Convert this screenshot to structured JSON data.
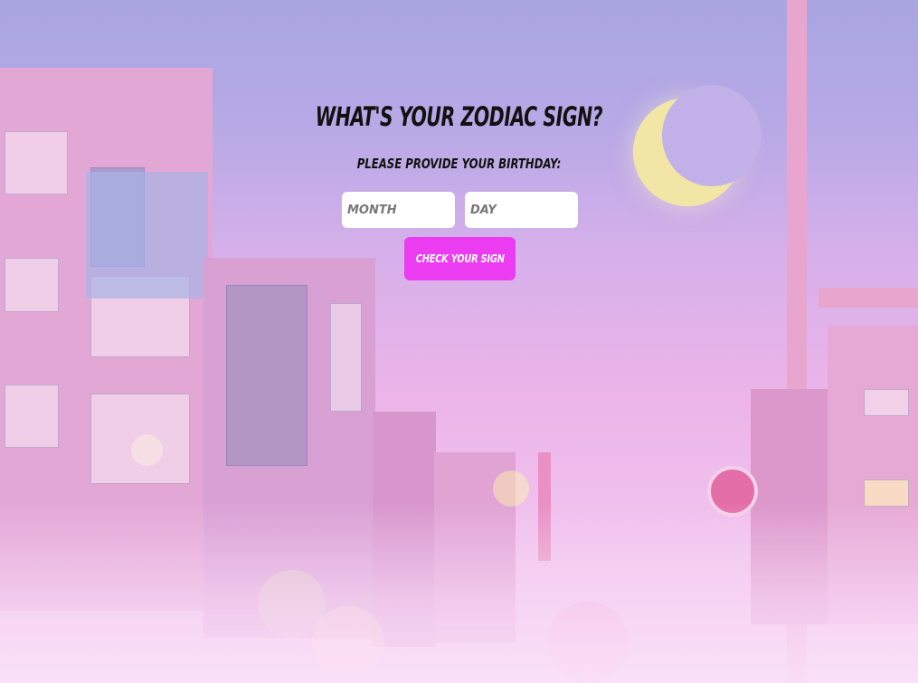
{
  "header": {
    "title": "What's your Zodiac sign?",
    "subtitle": "Please provide your birthday:"
  },
  "form": {
    "month_placeholder": "Month",
    "day_placeholder": "Day",
    "submit_label": "Check your sign"
  },
  "colors": {
    "button": "#ec3cf2",
    "input_bg": "#ffffff",
    "title_text": "#111111"
  }
}
